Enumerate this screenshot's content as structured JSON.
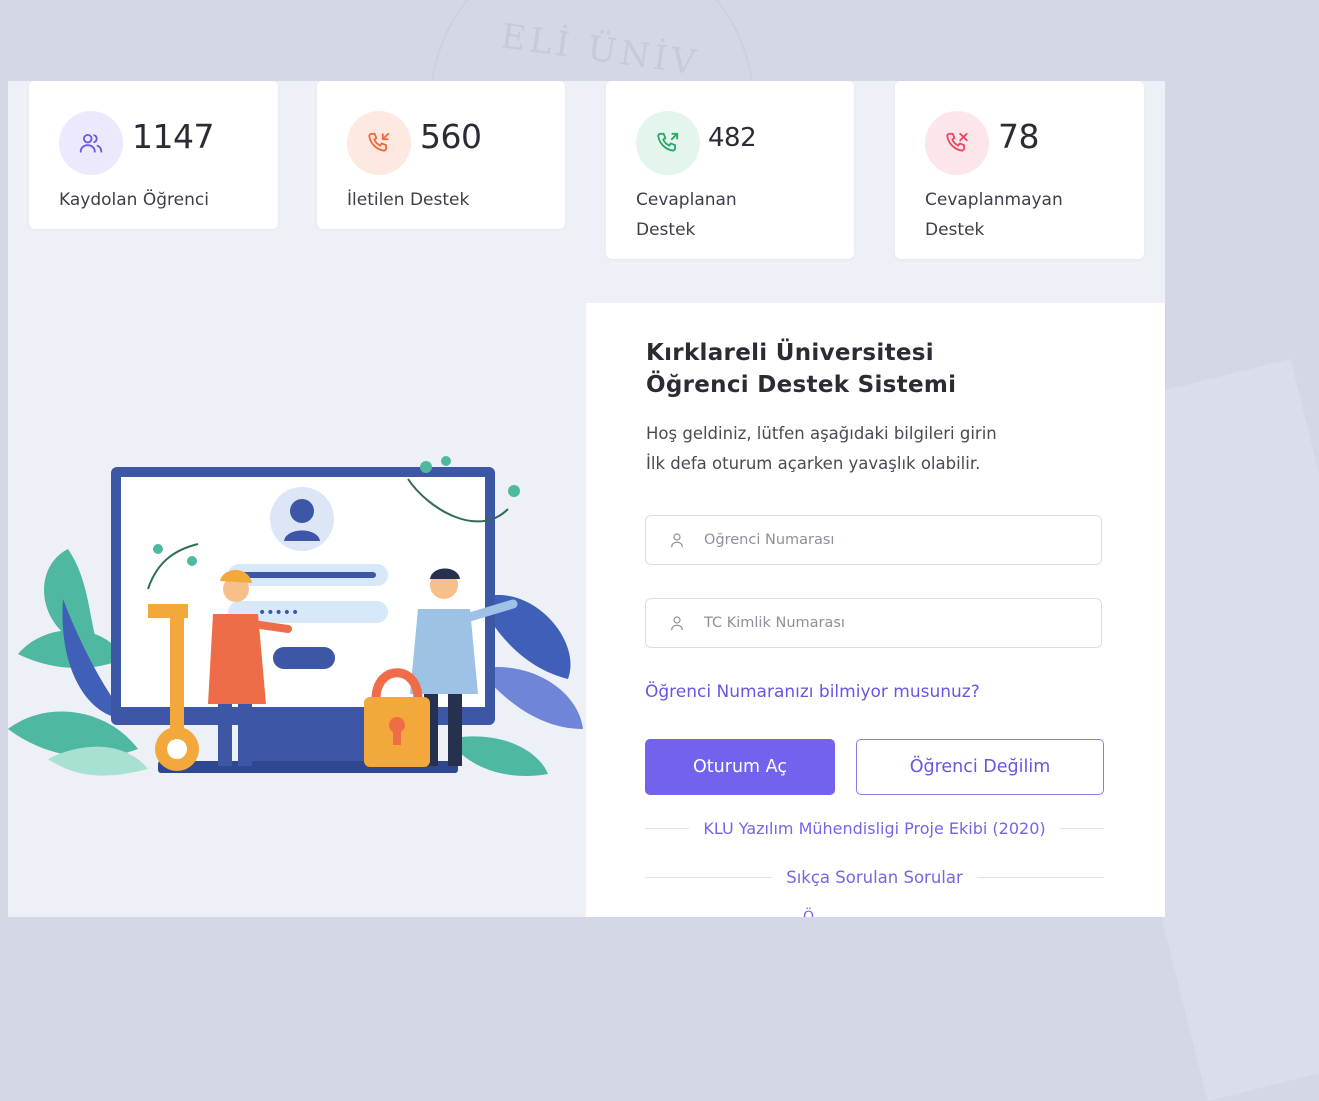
{
  "stats": [
    {
      "value": "1147",
      "label": "Kaydolan Öğrenci",
      "icon": "users-icon",
      "icon_bg": "#ece9fd",
      "icon_color": "#6a5ae0"
    },
    {
      "value": "560",
      "label": "İletilen Destek",
      "icon": "phone-incoming-icon",
      "icon_bg": "#fde9e2",
      "icon_color": "#f06a3b"
    },
    {
      "value": "482",
      "label": "Cevaplanan Destek",
      "icon": "phone-outgoing-icon",
      "icon_bg": "#e4f6ec",
      "icon_color": "#2aa86a"
    },
    {
      "value": "78",
      "label": "Cevaplanmayan Destek",
      "icon": "phone-missed-icon",
      "icon_bg": "#fde6ea",
      "icon_color": "#ea4866"
    }
  ],
  "login": {
    "title_line1": "Kırklareli Üniversitesi",
    "title_line2": "Öğrenci Destek Sistemi",
    "subtitle_line1": "Hoş geldiniz, lütfen aşağıdaki bilgileri girin",
    "subtitle_line2": "İlk defa oturum açarken yavaşlık olabilir.",
    "student_number": {
      "placeholder": "Öğrenci Numarası",
      "value": "",
      "icon": "user-icon"
    },
    "tc_number": {
      "placeholder": "TC Kimlik Numarası",
      "value": "",
      "icon": "user-icon"
    },
    "forgot_link": "Öğrenci Numaranızı bilmiyor musunuz?",
    "login_button": "Oturum Aç",
    "not_student_button": "Öğrenci Değilim",
    "credit_text": "KLU Yazılım Mühendisligi Proje Ekibi (2020)",
    "faq_link": "Sıkça Sorulan Sorular",
    "footer_partial": "Ö"
  },
  "background": {
    "seal_text": "ELİ ÜNİV"
  },
  "colors": {
    "accent": "#7262ee",
    "panel_bg": "#eef0f7",
    "page_bg": "#d3d7e6"
  }
}
